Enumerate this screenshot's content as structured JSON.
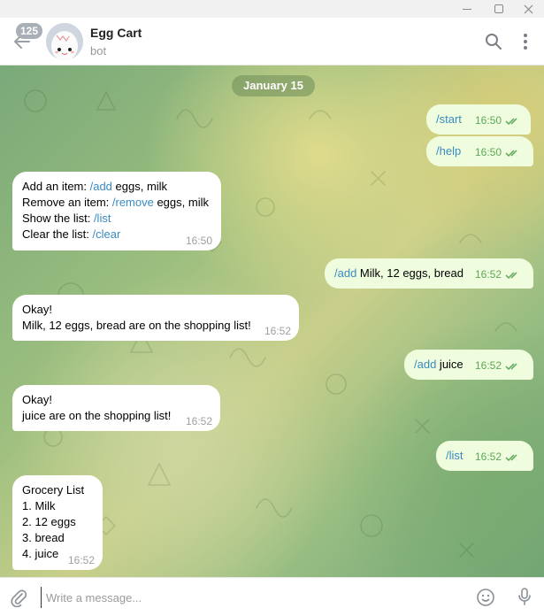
{
  "header": {
    "unread_badge": "125",
    "chat_title": "Egg Cart",
    "chat_subtitle": "bot"
  },
  "date_separator": "January 15",
  "messages": [
    {
      "dir": "out",
      "cmd": "/start",
      "text": "",
      "time": "16:50"
    },
    {
      "dir": "out",
      "cmd": "/help",
      "text": "",
      "time": "16:50"
    },
    {
      "dir": "in",
      "lines": [
        {
          "label": "Add an item: ",
          "cmd": "/add",
          "rest": " eggs, milk"
        },
        {
          "label": "Remove an item: ",
          "cmd": "/remove",
          "rest": " eggs, milk"
        },
        {
          "label": "Show the list: ",
          "cmd": "/list",
          "rest": ""
        },
        {
          "label": "Clear the list: ",
          "cmd": "/clear",
          "rest": ""
        }
      ],
      "time": "16:50"
    },
    {
      "dir": "out",
      "cmd": "/add",
      "text": " Milk, 12 eggs, bread",
      "time": "16:52"
    },
    {
      "dir": "in",
      "lines": [
        "Okay!",
        "Milk, 12 eggs, bread are on the shopping list!"
      ],
      "time": "16:52"
    },
    {
      "dir": "out",
      "cmd": "/add",
      "text": " juice",
      "time": "16:52"
    },
    {
      "dir": "in",
      "lines": [
        "Okay!",
        "juice are on the shopping list!"
      ],
      "time": "16:52"
    },
    {
      "dir": "out",
      "cmd": "/list",
      "text": "",
      "time": "16:52"
    },
    {
      "dir": "in",
      "lines": [
        "Grocery List",
        "1. Milk",
        "2. 12 eggs",
        "3. bread",
        "4. juice"
      ],
      "time": "16:52"
    }
  ],
  "composer": {
    "placeholder": "Write a message..."
  },
  "icons": {
    "back": "arrow-left-icon",
    "search": "search-icon",
    "menu": "more-vertical-icon",
    "attach": "paperclip-icon",
    "emoji": "smile-icon",
    "mic": "microphone-icon"
  },
  "colors": {
    "command_link": "#3a8bc2",
    "outgoing_bubble": "#effdde",
    "incoming_bubble": "#ffffff",
    "read_ticks": "#5ea75a"
  }
}
